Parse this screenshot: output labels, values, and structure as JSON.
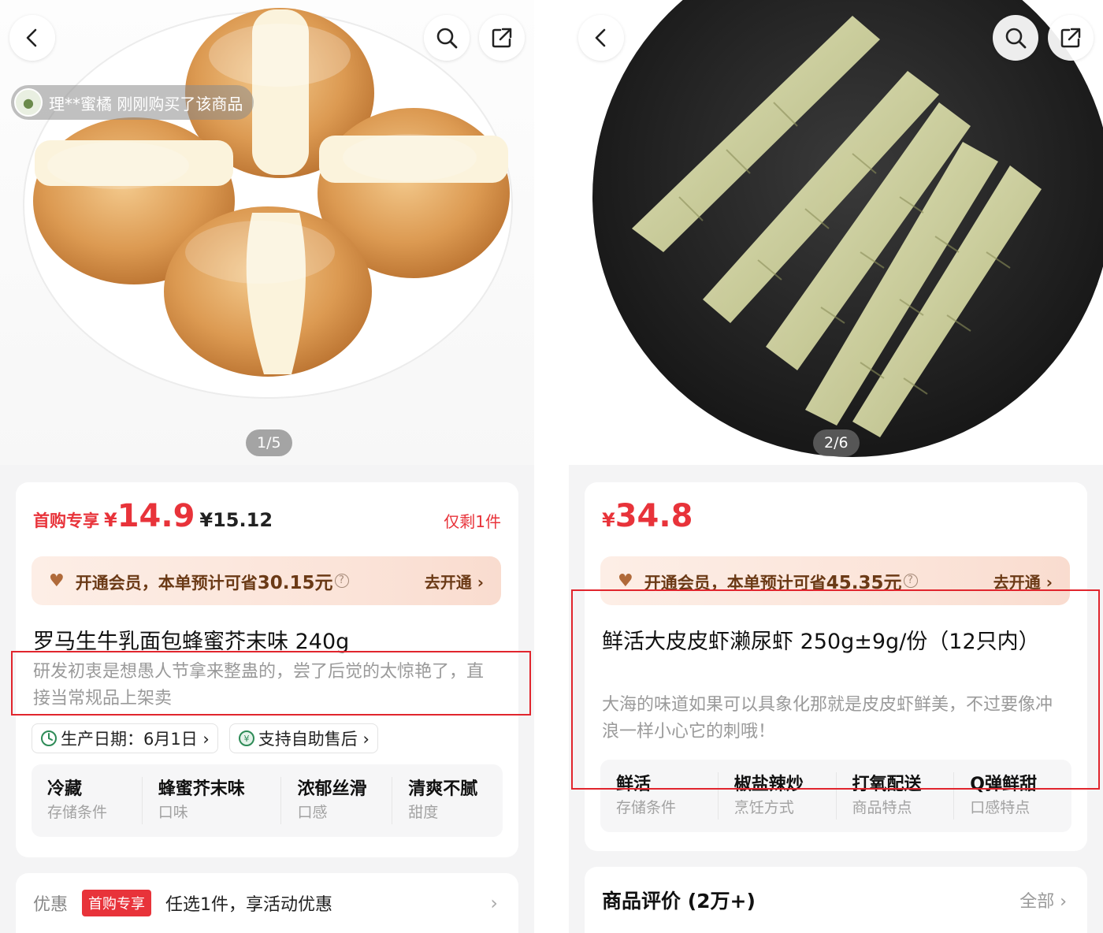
{
  "left": {
    "buyer_notice": "理**蜜橘 刚刚购买了该商品",
    "page_indicator": "1/5",
    "first_purchase_tag": "首购专享",
    "price_yen": "¥",
    "price": "14.9",
    "original_price": "¥15.12",
    "stock_text": "仅剩1件",
    "member_text": "开通会员，本单预计可省",
    "member_save": "30.15元",
    "member_go": "去开通 ›",
    "title": "罗马生牛乳面包蜂蜜芥末味 240g",
    "description": "研发初衷是想愚人节拿来整蛊的，尝了后觉的太惊艳了，直接当常规品上架卖",
    "chips": [
      {
        "label": "生产日期：6月1日 ›"
      },
      {
        "label": "支持自助售后 ›"
      }
    ],
    "attributes": [
      {
        "value": "冷藏",
        "key": "存储条件"
      },
      {
        "value": "蜂蜜芥末味",
        "key": "口味"
      },
      {
        "value": "浓郁丝滑",
        "key": "口感"
      },
      {
        "value": "清爽不腻",
        "key": "甜度"
      }
    ],
    "promo_label": "优惠",
    "promo_tag": "首购专享",
    "promo_text": "任选1件，享活动优惠",
    "promo_chevron": "›"
  },
  "right": {
    "page_indicator": "2/6",
    "price_yen": "¥",
    "price": "34.8",
    "member_text": "开通会员，本单预计可省",
    "member_save": "45.35元",
    "member_go": "去开通 ›",
    "title": "鲜活大皮皮虾濑尿虾 250g±9g/份（12只内）",
    "description": "大海的味道如果可以具象化那就是皮皮虾鲜美，不过要像冲浪一样小心它的刺哦！",
    "attributes": [
      {
        "value": "鲜活",
        "key": "存储条件"
      },
      {
        "value": "椒盐辣炒",
        "key": "烹饪方式"
      },
      {
        "value": "打氧配送",
        "key": "商品特点"
      },
      {
        "value": "Q弹鲜甜",
        "key": "口感特点"
      }
    ],
    "review_title": "商品评价 (2万+)",
    "review_all": "全部 ›"
  },
  "colors": {
    "accent_red": "#e8333a",
    "highlight_box": "#e1252d",
    "member_brown": "#6b3a16"
  },
  "icons": [
    "back-icon",
    "search-icon",
    "share-icon",
    "heart-icon",
    "clock-icon",
    "service-icon",
    "help-icon",
    "chevron-right-icon"
  ]
}
